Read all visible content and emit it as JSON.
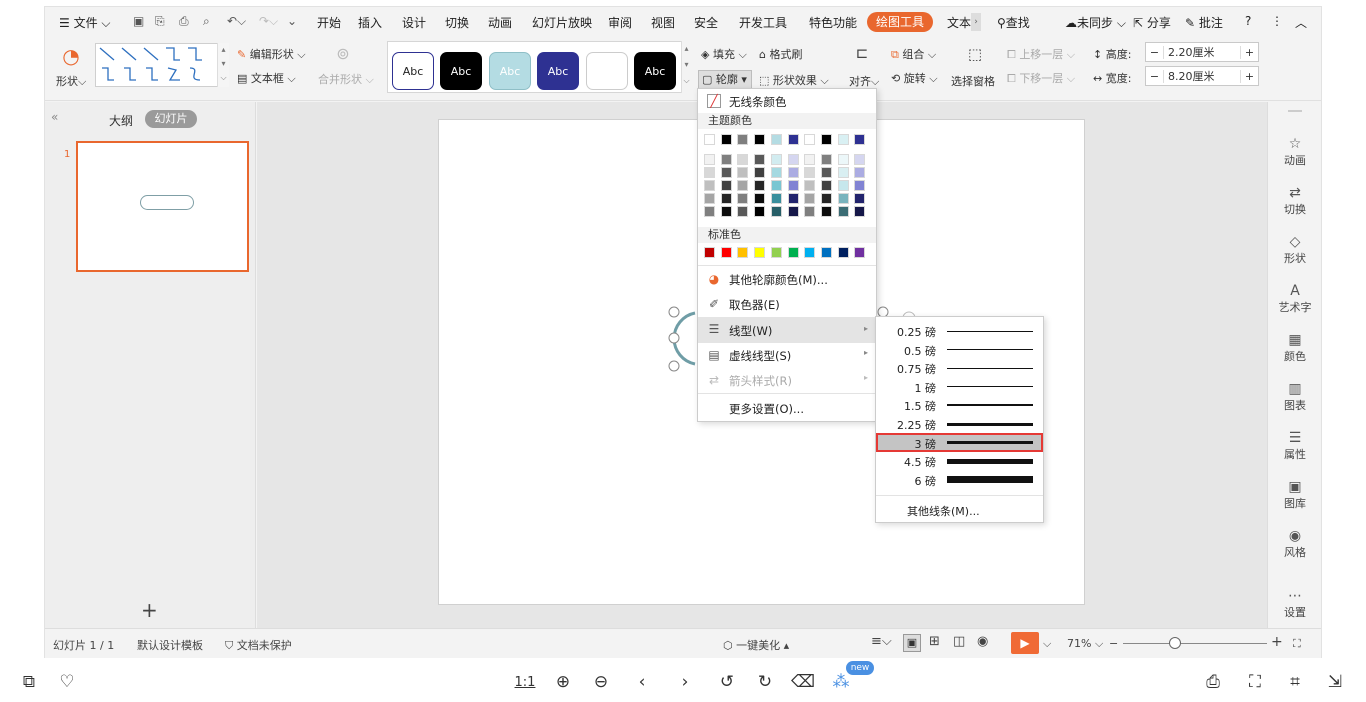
{
  "menubar": {
    "file_label": "文件",
    "tabs": [
      "开始",
      "插入",
      "设计",
      "切换",
      "动画",
      "幻灯片放映",
      "审阅",
      "视图",
      "安全",
      "开发工具",
      "特色功能"
    ],
    "active_tab": "绘图工具",
    "extra_tab": "文本",
    "search": "查找",
    "sync": "未同步",
    "share": "分享",
    "comment": "批注"
  },
  "ribbon": {
    "shape_label": "形状",
    "edit_shape": "编辑形状",
    "textbox": "文本框",
    "merge_shape": "合并形状",
    "style_samples": [
      "Abc",
      "Abc",
      "Abc",
      "Abc",
      "",
      "Abc"
    ],
    "fill": "填充",
    "format_painter": "格式刷",
    "outline": "轮廓",
    "shape_effect": "形状效果",
    "align": "对齐",
    "group": "组合",
    "rotate": "旋转",
    "selection_pane": "选择窗格",
    "bring_forward": "上移一层",
    "send_backward": "下移一层",
    "height_label": "高度:",
    "height_value": "2.20厘米",
    "width_label": "宽度:",
    "width_value": "8.20厘米"
  },
  "left_panel": {
    "tab_outline": "大纲",
    "tab_slides": "幻灯片",
    "slide_number": "1",
    "add_slide": "+"
  },
  "right_bar": [
    {
      "label": "动画",
      "icon": "animation-icon",
      "glyph": "☆"
    },
    {
      "label": "切换",
      "icon": "transition-icon",
      "glyph": "⇄"
    },
    {
      "label": "形状",
      "icon": "shape-icon",
      "glyph": "◇"
    },
    {
      "label": "艺术字",
      "icon": "wordart-icon",
      "glyph": "A"
    },
    {
      "label": "颜色",
      "icon": "color-icon",
      "glyph": "▦"
    },
    {
      "label": "图表",
      "icon": "chart-icon",
      "glyph": "▥"
    },
    {
      "label": "属性",
      "icon": "property-icon",
      "glyph": "☰"
    },
    {
      "label": "图库",
      "icon": "gallery-icon",
      "glyph": "▣"
    },
    {
      "label": "风格",
      "icon": "style-icon",
      "glyph": "◉"
    },
    {
      "label": "设置",
      "icon": "settings-icon",
      "glyph": "⋯"
    }
  ],
  "status": {
    "slide_count": "幻灯片 1 / 1",
    "template": "默认设计模板",
    "protect": "文档未保护",
    "beautify": "一键美化",
    "zoom": "71%"
  },
  "outline_menu": {
    "no_line": "无线条颜色",
    "theme_colors": "主题颜色",
    "standard_colors": "标准色",
    "more_colors": "其他轮廓颜色(M)...",
    "eyedropper": "取色器(E)",
    "line_type": "线型(W)",
    "dash_type": "虚线线型(S)",
    "arrow_style": "箭头样式(R)",
    "more_settings": "更多设置(O)...",
    "theme_top": [
      "#ffffff",
      "#000000",
      "#7f7f7f",
      "#000000",
      "#b4dce3",
      "#2e3192",
      "#ffffff",
      "#000000",
      "#d9f0f3",
      "#2e3192"
    ],
    "theme_grid": [
      [
        "#f2f2f2",
        "#7f7f7f",
        "#d8d8d8",
        "#595959",
        "#d2ecf0",
        "#d5d6f0",
        "#f2f2f2",
        "#7f7f7f",
        "#ecf7f9",
        "#d5d6f0"
      ],
      [
        "#d8d8d8",
        "#595959",
        "#bfbfbf",
        "#404040",
        "#a5d9e1",
        "#abace2",
        "#d8d8d8",
        "#595959",
        "#d9eff2",
        "#abace2"
      ],
      [
        "#bfbfbf",
        "#404040",
        "#a5a5a5",
        "#262626",
        "#79c6d2",
        "#8183d3",
        "#bfbfbf",
        "#404040",
        "#c6e7ec",
        "#8183d3"
      ],
      [
        "#a5a5a5",
        "#262626",
        "#7f7f7f",
        "#0d0d0d",
        "#3a8f9d",
        "#22246d",
        "#a5a5a5",
        "#262626",
        "#79b3bd",
        "#22246d"
      ],
      [
        "#7f7f7f",
        "#0d0d0d",
        "#595959",
        "#000000",
        "#275f68",
        "#161849",
        "#7f7f7f",
        "#0d0d0d",
        "#3b6c74",
        "#161849"
      ]
    ],
    "standard": [
      "#c00000",
      "#ff0000",
      "#ffc000",
      "#ffff00",
      "#92d050",
      "#00b050",
      "#00b0f0",
      "#0070c0",
      "#002060",
      "#7030a0"
    ]
  },
  "linetype_menu": {
    "items": [
      {
        "label": "0.25 磅",
        "weight": 0.25
      },
      {
        "label": "0.5 磅",
        "weight": 0.5
      },
      {
        "label": "0.75 磅",
        "weight": 0.75
      },
      {
        "label": "1 磅",
        "weight": 1
      },
      {
        "label": "1.5 磅",
        "weight": 1.5
      },
      {
        "label": "2.25 磅",
        "weight": 2.25
      },
      {
        "label": "3 磅",
        "weight": 3
      },
      {
        "label": "4.5 磅",
        "weight": 4.5
      },
      {
        "label": "6 磅",
        "weight": 6
      }
    ],
    "selected": "3 磅",
    "more_lines": "其他线条(M)..."
  },
  "colors": {
    "accent": "#e9672e",
    "selected_outline": "#e53935",
    "play": "#f06a35"
  }
}
